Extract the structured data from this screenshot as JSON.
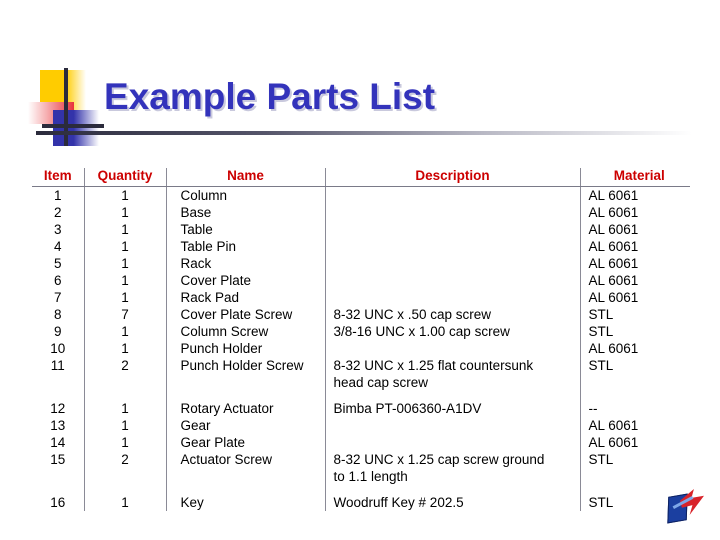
{
  "slide": {
    "title": "Example Parts List",
    "motif_colors": {
      "yellow": "#FFCC00",
      "red": "#E8323C",
      "blue": "#3333AA",
      "bar": "#2b2b3c"
    },
    "title_color": "#3333BB",
    "header_color": "#CC0000"
  },
  "table": {
    "headers": [
      "Item",
      "Quantity",
      "Name",
      "Description",
      "Material"
    ],
    "rows": [
      {
        "item": "1",
        "quantity": "1",
        "name": "Column",
        "description": "",
        "description2": "",
        "material": "AL 6061"
      },
      {
        "item": "2",
        "quantity": "1",
        "name": "Base",
        "description": "",
        "description2": "",
        "material": "AL 6061"
      },
      {
        "item": "3",
        "quantity": "1",
        "name": "Table",
        "description": "",
        "description2": "",
        "material": "AL 6061"
      },
      {
        "item": "4",
        "quantity": "1",
        "name": "Table Pin",
        "description": "",
        "description2": "",
        "material": "AL 6061"
      },
      {
        "item": "5",
        "quantity": "1",
        "name": "Rack",
        "description": "",
        "description2": "",
        "material": "AL 6061"
      },
      {
        "item": "6",
        "quantity": "1",
        "name": "Cover Plate",
        "description": "",
        "description2": "",
        "material": "AL 6061"
      },
      {
        "item": "7",
        "quantity": "1",
        "name": "Rack Pad",
        "description": "",
        "description2": "",
        "material": "AL 6061"
      },
      {
        "item": "8",
        "quantity": "7",
        "name": "Cover Plate Screw",
        "description": "8-32 UNC x .50 cap screw",
        "description2": "",
        "material": "STL"
      },
      {
        "item": "9",
        "quantity": "1",
        "name": "Column Screw",
        "description": "3/8-16 UNC x 1.00 cap screw",
        "description2": "",
        "material": "STL"
      },
      {
        "item": "10",
        "quantity": "1",
        "name": "Punch Holder",
        "description": "",
        "description2": "",
        "material": "AL 6061"
      },
      {
        "item": "11",
        "quantity": "2",
        "name": "Punch Holder Screw",
        "description": "8-32 UNC x 1.25 flat countersunk",
        "description2": "head cap screw",
        "material": "STL"
      },
      {
        "item": "12",
        "quantity": "1",
        "name": "Rotary Actuator",
        "description": "Bimba PT-006360-A1DV",
        "description2": "",
        "material": "--"
      },
      {
        "item": "13",
        "quantity": "1",
        "name": "Gear",
        "description": "",
        "description2": "",
        "material": "AL 6061"
      },
      {
        "item": "14",
        "quantity": "1",
        "name": "Gear Plate",
        "description": "",
        "description2": "",
        "material": "AL 6061"
      },
      {
        "item": "15",
        "quantity": "2",
        "name": "Actuator Screw",
        "description": "8-32 UNC x 1.25 cap screw ground",
        "description2": "to 1.1 length",
        "material": "STL"
      },
      {
        "item": "16",
        "quantity": "1",
        "name": "Key",
        "description": "Woodruff Key # 202.5",
        "description2": "",
        "material": "STL"
      }
    ]
  },
  "corner_logo": {
    "name": "arrow-logo",
    "colors": {
      "blue": "#1b3fa0",
      "red": "#d8232a"
    }
  }
}
